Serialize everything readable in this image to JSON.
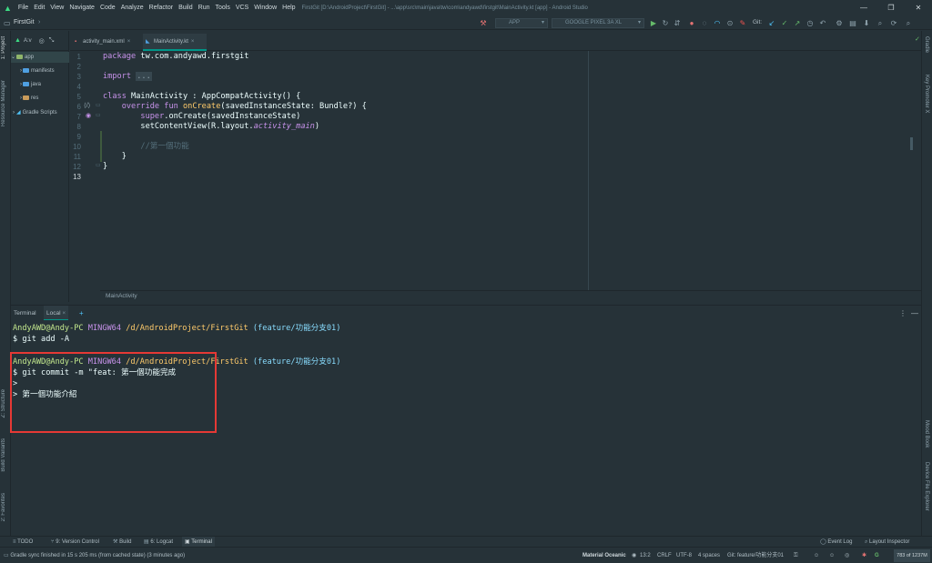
{
  "menu": {
    "items": [
      "File",
      "Edit",
      "View",
      "Navigate",
      "Code",
      "Analyze",
      "Refactor",
      "Build",
      "Run",
      "Tools",
      "VCS",
      "Window",
      "Help"
    ],
    "window_title": "FirstGit [D:\\AndroidProject\\FirstGit] - ...\\app\\src\\main\\java\\tw\\com\\andyawd\\firstgit\\MainActivity.kt [app] - Android Studio"
  },
  "toolbar": {
    "project_crumb": "FirstGit",
    "run_config": "APP",
    "device": "GOOGLE PIXEL 3A XL",
    "git_label": "Git:"
  },
  "left_stripe": {
    "project": "1: Project",
    "resource_manager": "Resource Manager",
    "structure": "Z: Structure",
    "build_variants": "Build Variants",
    "favorites": "2: Favorites"
  },
  "right_stripe": {
    "gradle": "Gradle",
    "key_promoter": "Key Promoter X",
    "mood_book": "Mood Book",
    "device_explorer": "Device File Explorer"
  },
  "project_panel": {
    "view_label": "A:v",
    "items": [
      {
        "label": "app"
      },
      {
        "label": "manifests"
      },
      {
        "label": "java"
      },
      {
        "label": "res"
      },
      {
        "label": "Gradle Scripts"
      }
    ]
  },
  "editor": {
    "tabs": [
      {
        "label": "activity_main.xml",
        "close": "×"
      },
      {
        "label": "MainActivity.kt",
        "close": "×"
      }
    ],
    "line_numbers": [
      "1",
      "2",
      "3",
      "4",
      "5",
      "6",
      "7",
      "8",
      "9",
      "10",
      "11",
      "12",
      "13"
    ],
    "code": {
      "l1_kw": "package",
      "l1_rest": " tw.com.andyawd.firstgit",
      "l3_kw": "import",
      "l3_fold": "...",
      "l6_kw": "class",
      "l6_rest": " MainActivity : AppCompatActivity() {",
      "l7_kw": "override fun",
      "l7_fn": "onCreate",
      "l7_rest": "(savedInstanceState: Bundle?) {",
      "l8_kw": "super",
      "l8_rest": ".onCreate(savedInstanceState)",
      "l9_a": "setContentView(R.layout.",
      "l9_it": "activity_main",
      "l9_b": ")",
      "l11_cmt": "//第一個功能",
      "l12": "}",
      "l13": "}"
    },
    "breadcrumb": "MainActivity"
  },
  "terminal": {
    "tabs": {
      "terminal": "Terminal",
      "local": "Local",
      "close": "×",
      "add": "+"
    },
    "prompt1": {
      "user": "AndyAWD@Andy-PC",
      "host": "MINGW64",
      "path": "/d/AndroidProject/FirstGit",
      "branch": "(feature/功能分支01)"
    },
    "cmd1": "$ git add -A",
    "prompt2": {
      "user": "AndyAWD@Andy-PC",
      "host": "MINGW64",
      "path": "/d/AndroidProject/FirstGit",
      "branch": "(feature/功能分支01)"
    },
    "cmd2": "$ git commit -m \"feat: 第一個功能完成",
    "cont1": ">",
    "cont2": "> 第一個功能介紹"
  },
  "toolwindows": {
    "todo": "TODO",
    "version_control": "9: Version Control",
    "build": "Build",
    "logcat": "6: Logcat",
    "terminal": "Terminal",
    "event_log": "Event Log",
    "layout_inspector": "Layout Inspector"
  },
  "status": {
    "message": "Gradle sync finished in 15 s 205 ms (from cached state) (3 minutes ago)",
    "theme": "Material Oceanic",
    "position": "13:2",
    "line_sep": "CRLF",
    "encoding": "UTF-8",
    "indent": "4 spaces",
    "branch": "Git: feature/功能分支01",
    "memory": "783 of 1237M"
  },
  "colors": {
    "accent": "#009688",
    "highlight_box": "#e53935",
    "background": "#263238"
  }
}
